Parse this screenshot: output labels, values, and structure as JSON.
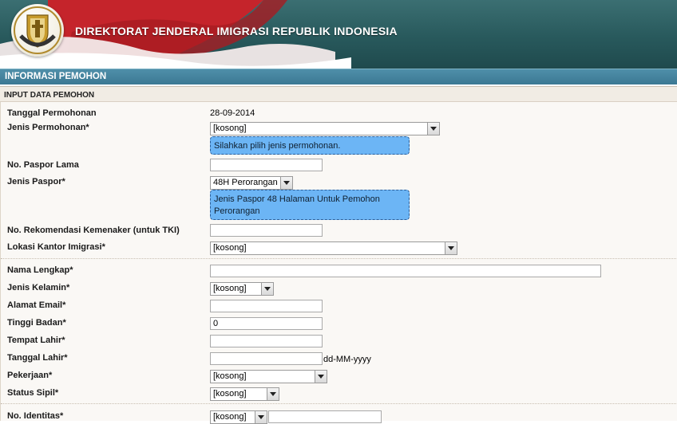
{
  "header": {
    "title": "DIREKTORAT JENDERAL IMIGRASI REPUBLIK INDONESIA",
    "logo_text": "IMIGRASI"
  },
  "section": {
    "title": "INFORMASI PEMOHON",
    "subtitle": "INPUT DATA PEMOHON"
  },
  "form": {
    "tanggal_permohonan": {
      "label": "Tanggal Permohonan",
      "value": "28-09-2014"
    },
    "jenis_permohonan": {
      "label": "Jenis Permohonan*",
      "selected": "[kosong]",
      "tip": "Silahkan pilih jenis permohonan."
    },
    "no_paspor_lama": {
      "label": "No. Paspor Lama",
      "value": ""
    },
    "jenis_paspor": {
      "label": "Jenis Paspor*",
      "selected": "48H Perorangan",
      "tip": "Jenis Paspor 48 Halaman Untuk Pemohon Perorangan"
    },
    "no_rekomendasi": {
      "label": "No. Rekomendasi Kemenaker (untuk TKI)",
      "value": ""
    },
    "lokasi_kantor": {
      "label": "Lokasi Kantor Imigrasi*",
      "selected": "[kosong]"
    },
    "nama_lengkap": {
      "label": "Nama Lengkap*",
      "value": ""
    },
    "jenis_kelamin": {
      "label": "Jenis Kelamin*",
      "selected": "[kosong]"
    },
    "alamat_email": {
      "label": "Alamat Email*",
      "value": ""
    },
    "tinggi_badan": {
      "label": "Tinggi Badan*",
      "value": "0"
    },
    "tempat_lahir": {
      "label": "Tempat Lahir*",
      "value": ""
    },
    "tanggal_lahir": {
      "label": "Tanggal Lahir*",
      "value": "",
      "format_hint": "dd-MM-yyyy"
    },
    "pekerjaan": {
      "label": "Pekerjaan*",
      "selected": "[kosong]"
    },
    "status_sipil": {
      "label": "Status Sipil*",
      "selected": "[kosong]"
    },
    "no_identitas": {
      "label": "No. Identitas*",
      "selected": "[kosong]",
      "value": ""
    }
  }
}
